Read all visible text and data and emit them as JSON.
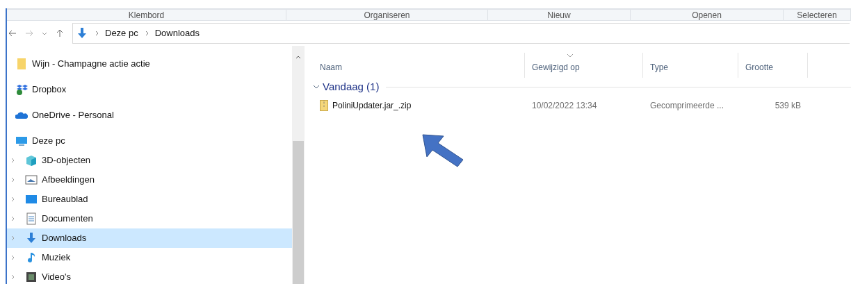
{
  "ribbon_groups": [
    "Klembord",
    "Organiseren",
    "Nieuw",
    "Openen",
    "Selecteren"
  ],
  "address_bar": {
    "path": [
      "Deze pc",
      "Downloads"
    ]
  },
  "sidebar": {
    "items": [
      {
        "label": "Wijn - Champagne actie actie",
        "kind": "folder",
        "selected": false
      },
      {
        "label": "Dropbox",
        "kind": "dropbox",
        "selected": false
      },
      {
        "label": "OneDrive - Personal",
        "kind": "cloud",
        "selected": false
      },
      {
        "label": "Deze pc",
        "kind": "pc",
        "selected": false,
        "children": [
          {
            "label": "3D-objecten",
            "kind": "cube",
            "selected": false
          },
          {
            "label": "Afbeeldingen",
            "kind": "pictures",
            "selected": false
          },
          {
            "label": "Bureaublad",
            "kind": "desktop",
            "selected": false
          },
          {
            "label": "Documenten",
            "kind": "documents",
            "selected": false
          },
          {
            "label": "Downloads",
            "kind": "downloads",
            "selected": true
          },
          {
            "label": "Muziek",
            "kind": "music",
            "selected": false
          },
          {
            "label": "Video's",
            "kind": "videos",
            "selected": false
          }
        ]
      }
    ]
  },
  "table": {
    "columns": [
      {
        "label": "Naam",
        "sorted": false
      },
      {
        "label": "Gewijzigd op",
        "sorted": true
      },
      {
        "label": "Type",
        "sorted": false
      },
      {
        "label": "Grootte",
        "sorted": false
      }
    ],
    "groups": [
      {
        "label": "Vandaag (1)",
        "expanded": true,
        "rows": [
          {
            "name": "PoliniUpdater.jar_.zip",
            "modified": "10/02/2022 13:34",
            "type": "Gecomprimeerde ...",
            "size": "539 kB"
          }
        ]
      }
    ]
  }
}
